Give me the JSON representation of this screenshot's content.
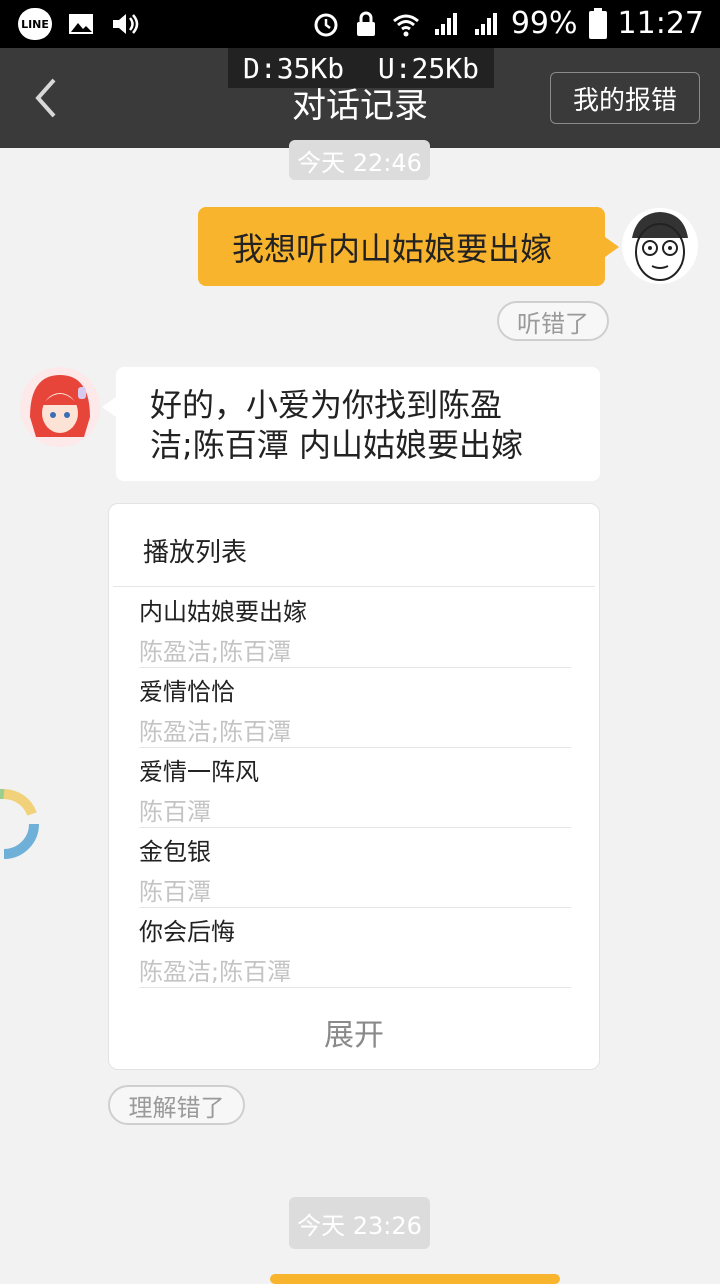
{
  "status_bar": {
    "battery": "99%",
    "time": "11:27",
    "line_label": "LINE"
  },
  "speed_overlay": "D:35Kb  U:25Kb",
  "header": {
    "title": "对话记录",
    "report_button": "我的报错"
  },
  "timestamps": [
    "今天 22:46",
    "今天 23:26"
  ],
  "user_message": "我想听内山姑娘要出嫁",
  "misheard_button": "听错了",
  "bot_reply": {
    "line1": "好的，小爱为你找到陈盈",
    "line2": "洁;陈百潭 内山姑娘要出嫁"
  },
  "playlist": {
    "title": "播放列表",
    "songs": [
      {
        "name": "内山姑娘要出嫁",
        "artist": "陈盈洁;陈百潭"
      },
      {
        "name": "爱情恰恰",
        "artist": "陈盈洁;陈百潭"
      },
      {
        "name": "爱情一阵风",
        "artist": "陈百潭"
      },
      {
        "name": "金包银",
        "artist": "陈百潭"
      },
      {
        "name": "你会后悔",
        "artist": "陈盈洁;陈百潭"
      }
    ],
    "expand": "展开"
  },
  "misunderstood_button": "理解错了",
  "colors": {
    "accent": "#f9b42d",
    "header_bg": "#3a3a3a",
    "page_bg": "#f2f2f2"
  }
}
